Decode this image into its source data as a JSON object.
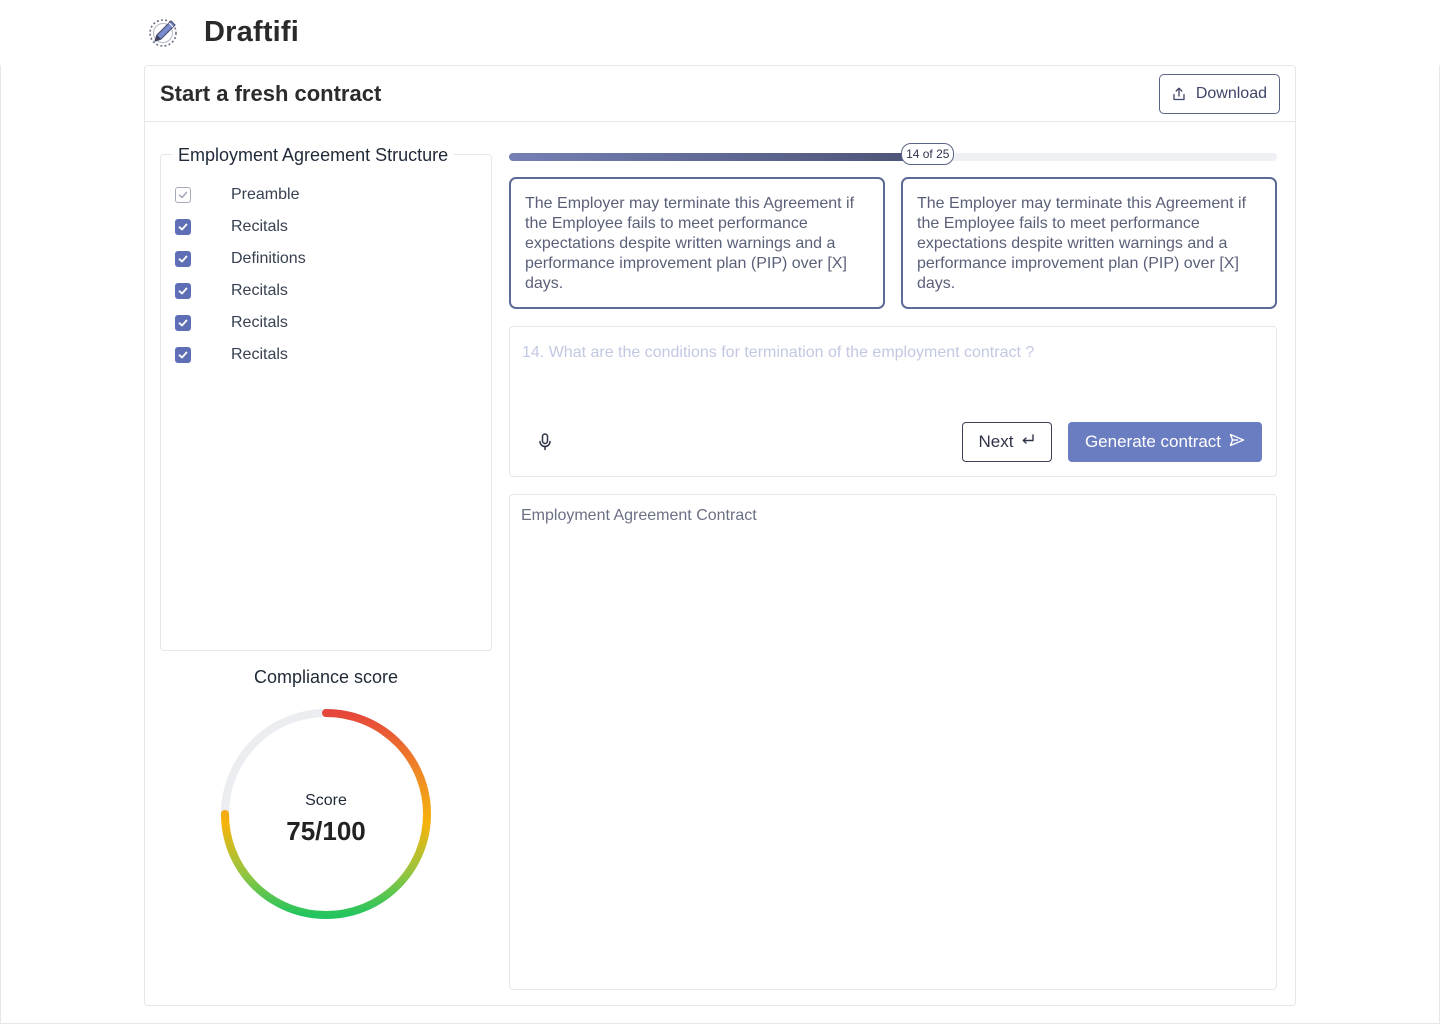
{
  "app": {
    "name": "Draftifi",
    "logo_icon": "pen-logo-icon"
  },
  "card": {
    "title": "Start a fresh contract",
    "download_label": "Download",
    "download_icon": "upload-share-icon"
  },
  "structure": {
    "title": "Employment Agreement Structure",
    "items": [
      {
        "label": "Preamble",
        "checked": true,
        "style": "outline"
      },
      {
        "label": "Recitals",
        "checked": true
      },
      {
        "label": "Definitions",
        "checked": true
      },
      {
        "label": "Recitals",
        "checked": true
      },
      {
        "label": "Recitals",
        "checked": true
      },
      {
        "label": "Recitals",
        "checked": true
      }
    ]
  },
  "compliance": {
    "title": "Compliance score",
    "score_label": "Score",
    "score_text": "75/100",
    "score_value": 75,
    "score_max": 100,
    "gradient_colors": [
      "#e6463b",
      "#f08a24",
      "#f5b40c",
      "#9bc53d",
      "#22c55e"
    ],
    "track_color": "#ebedf1"
  },
  "progress": {
    "current": 14,
    "total": 25,
    "badge_text": "14 of 25"
  },
  "suggestions": [
    {
      "text": "The Employer may terminate this Agreement if the Employee fails to meet performance expectations despite written warnings and a performance improvement plan (PIP) over [X] days."
    },
    {
      "text": "The Employer may terminate this Agreement if the Employee fails to meet performance expectations despite written warnings and a performance improvement plan (PIP) over [X] days."
    }
  ],
  "question": {
    "placeholder": "14. What are the conditions for termination of the employment contract ?",
    "value": "",
    "mic_icon": "microphone-icon",
    "next_label": "Next",
    "next_icon": "enter-return-icon",
    "generate_label": "Generate contract",
    "generate_icon": "send-icon"
  },
  "contract": {
    "title": "Employment Agreement Contract"
  },
  "colors": {
    "accent": "#6b7dc1",
    "checkbox": "#5e6fb8",
    "suggestion_border": "#5e6a98"
  }
}
